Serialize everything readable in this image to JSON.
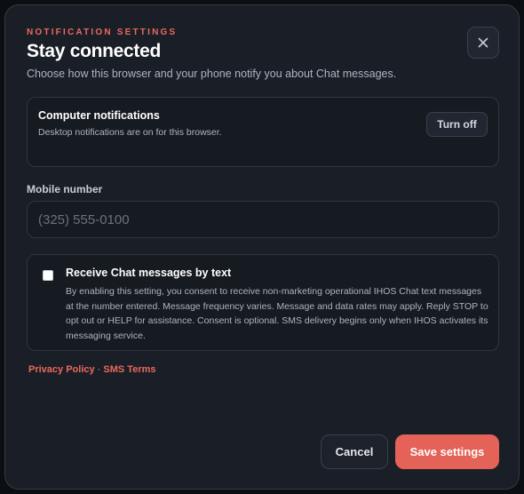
{
  "header": {
    "eyebrow": "NOTIFICATION SETTINGS",
    "title": "Stay connected",
    "subtitle": "Choose how this browser and your phone notify you about Chat messages.",
    "close_icon": "close-icon"
  },
  "computer_notifications": {
    "title": "Computer notifications",
    "description": "Desktop notifications are on for this browser.",
    "button_label": "Turn off"
  },
  "mobile": {
    "label": "Mobile number",
    "placeholder": "(325) 555-0100",
    "value": ""
  },
  "sms": {
    "checked": false,
    "title": "Receive Chat messages by text",
    "description": "By enabling this setting, you consent to receive non-marketing operational IHOS Chat text messages at the number entered. Message frequency varies. Message and data rates may apply. Reply STOP to opt out or HELP for assistance. Consent is optional. SMS delivery begins only when IHOS activates its messaging service."
  },
  "links": {
    "privacy": "Privacy Policy",
    "separator": "·",
    "sms_terms": "SMS Terms"
  },
  "footer": {
    "cancel_label": "Cancel",
    "save_label": "Save settings"
  },
  "colors": {
    "accent": "#e46257",
    "background": "#1a1e26",
    "card": "#161a21"
  }
}
